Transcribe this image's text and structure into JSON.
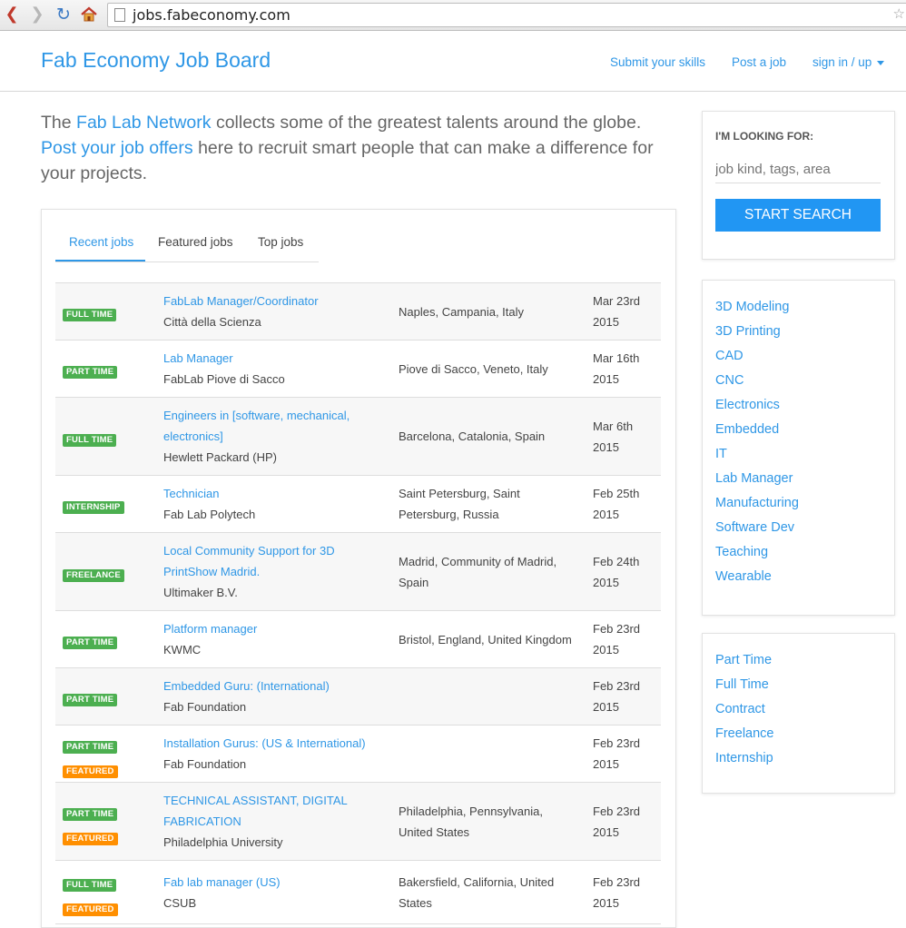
{
  "browser": {
    "url": "jobs.fabeconomy.com"
  },
  "header": {
    "brand": "Fab Economy Job Board",
    "nav": {
      "submit_skills": "Submit your skills",
      "post_job": "Post a job",
      "sign_in": "sign in / up"
    }
  },
  "intro": {
    "text1": "The ",
    "link1": "Fab Lab Network",
    "text2": " collects some of the greatest talents around the globe. ",
    "link2": "Post your job offers",
    "text3": " here to recruit smart people that can make a difference for your projects."
  },
  "tabs": [
    "Recent jobs",
    "Featured jobs",
    "Top jobs"
  ],
  "jobs": [
    {
      "badges": [
        "FULL TIME"
      ],
      "title": "FabLab Manager/Coordinator",
      "company": "Città della Scienza",
      "location": "Naples, Campania, Italy",
      "date": "Mar 23rd 2015"
    },
    {
      "badges": [
        "PART TIME"
      ],
      "title": "Lab Manager",
      "company": "FabLab Piove di Sacco",
      "location": "Piove di Sacco, Veneto, Italy",
      "date": "Mar 16th 2015"
    },
    {
      "badges": [
        "FULL TIME"
      ],
      "title": "Engineers in [software, mechanical, electronics]",
      "company": "Hewlett Packard (HP)",
      "location": "Barcelona, Catalonia, Spain",
      "date": "Mar 6th 2015"
    },
    {
      "badges": [
        "INTERNSHIP"
      ],
      "title": "Technician",
      "company": "Fab Lab Polytech",
      "location": "Saint Petersburg, Saint Petersburg, Russia",
      "date": "Feb 25th 2015"
    },
    {
      "badges": [
        "FREELANCE"
      ],
      "title": "Local Community Support for 3D PrintShow Madrid.",
      "company": "Ultimaker B.V.",
      "location": "Madrid, Community of Madrid, Spain",
      "date": "Feb 24th 2015"
    },
    {
      "badges": [
        "PART TIME"
      ],
      "title": "Platform manager",
      "company": "KWMC",
      "location": "Bristol, England, United Kingdom",
      "date": "Feb 23rd 2015"
    },
    {
      "badges": [
        "PART TIME"
      ],
      "title": "Embedded Guru: (International)",
      "company": "Fab Foundation",
      "location": "",
      "date": "Feb 23rd 2015"
    },
    {
      "badges": [
        "PART TIME",
        "FEATURED"
      ],
      "title": "Installation Gurus: (US & International)",
      "company": "Fab Foundation",
      "location": "",
      "date": "Feb 23rd 2015"
    },
    {
      "badges": [
        "PART TIME",
        "FEATURED"
      ],
      "title": "TECHNICAL ASSISTANT, DIGITAL FABRICATION",
      "company": "Philadelphia University",
      "location": "Philadelphia, Pennsylvania, United States",
      "date": "Feb 23rd 2015"
    },
    {
      "badges": [
        "FULL TIME",
        "FEATURED"
      ],
      "title": "Fab lab manager (US)",
      "company": "CSUB",
      "location": "Bakersfield, California, United States",
      "date": "Feb 23rd 2015"
    }
  ],
  "search": {
    "label": "I'M LOOKING FOR:",
    "placeholder": "job kind, tags, area",
    "button": "START SEARCH"
  },
  "tags": [
    "3D Modeling",
    "3D Printing",
    "CAD",
    "CNC",
    "Electronics",
    "Embedded",
    "IT",
    "Lab Manager",
    "Manufacturing",
    "Software Dev",
    "Teaching",
    "Wearable"
  ],
  "job_types": [
    "Part Time",
    "Full Time",
    "Contract",
    "Freelance",
    "Internship"
  ],
  "colors": {
    "accent": "#2f97e6",
    "badge_green": "#4caf50",
    "badge_orange": "#ff8f00",
    "button": "#2196f3"
  }
}
